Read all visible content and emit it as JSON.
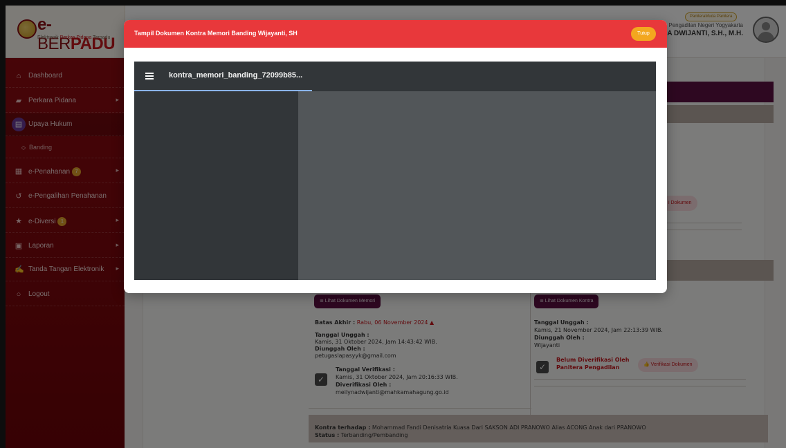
{
  "app": {
    "logo_title_e": "e-",
    "logo_title_ber": "BER",
    "logo_title_padu": "PADU",
    "logo_sub_1": "Elektronik ",
    "logo_sub_2": "Berkas Pidana",
    "logo_sub_3": " Terpadu"
  },
  "user": {
    "role": "PaniteraMuda Panitera",
    "court": "Pengadilan Negeri Yogyakarta",
    "name": "NA DWIJANTI, S.H., M.H."
  },
  "sidebar": {
    "items": [
      {
        "label": "Dashboard",
        "icon": "home-icon"
      },
      {
        "label": "Perkara Pidana",
        "icon": "folder-icon"
      },
      {
        "label": "Upaya Hukum",
        "icon": "document-icon"
      },
      {
        "label": "Banding",
        "icon": "diamond-icon"
      },
      {
        "label": "e-Penahanan",
        "icon": "grid-icon",
        "badge": "7"
      },
      {
        "label": "e-Pengalihan Penahanan",
        "icon": "history-icon"
      },
      {
        "label": "e-Diversi",
        "icon": "star-icon",
        "badge": "1"
      },
      {
        "label": "Laporan",
        "icon": "chart-icon"
      },
      {
        "label": "Tanda Tangan Elektronik",
        "icon": "signature-icon"
      },
      {
        "label": "Logout",
        "icon": "power-icon"
      }
    ]
  },
  "background": {
    "verif_top_label": "i Dokumen",
    "btn_memori": "≣ Lihat Dokumen Memori",
    "btn_kontra": "≣ Lihat Dokumen Kontra",
    "batas_akhir_label": "Batas Akhir :",
    "batas_akhir_value": " Rabu, 06 November 2024 ▲",
    "left_upload_label": "Tanggal Unggah :",
    "left_upload_value": "Kamis, 31 Oktober 2024, Jam 14:43:42 WIB.",
    "left_uploader_label": "Diunggah Oleh :",
    "left_uploader_value": "petugaslapasyyk@gmail.com",
    "left_verif_label": "Tanggal Verifikasi :",
    "left_verif_value": "Kamis, 31 Oktober 2024, Jam 20:16:33 WIB.",
    "left_verifier_label": "Diverifikasi Oleh :",
    "left_verifier_value": "meilynadwijanti@mahkamahagung.go.id",
    "right_upload_label": "Tanggal Unggah :",
    "right_upload_value": "Kamis, 21 November 2024, Jam 22:13:39 WIB.",
    "right_uploader_label": "Diunggah Oleh :",
    "right_uploader_value": "Wijayanti",
    "right_status_1": "Belum Diverifikasi Oleh",
    "right_status_2": "Panitera Pengadilan",
    "verif_button": "👍 Verifikasi Dokumen",
    "kontra_label": "Kontra terhadap :",
    "kontra_value": " Mohammad Fandi Denisatria Kuasa Dari SAKSON ADI PRANOWO Alias ACONG Anak dari PRANOWO",
    "status_label": "Status :",
    "status_value": " Terbanding/Pembanding"
  },
  "modal": {
    "title": "Tampil Dokumen Kontra Memori Banding Wijayanti, SH",
    "close_label": "Tutup",
    "file_name": "kontra_memori_banding_72099b85..."
  },
  "colors": {
    "sidebar": "#8e0b11",
    "modal_header": "#e8383b",
    "close_button": "#f3a71f",
    "doc_button": "#5c1143"
  }
}
